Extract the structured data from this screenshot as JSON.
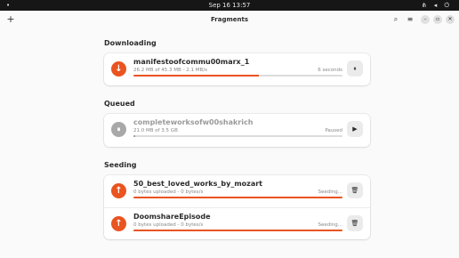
{
  "topbar": {
    "activities": "•",
    "clock": "Sep 16  13:57",
    "system": "⋔ ◂ ⏻"
  },
  "header": {
    "add_icon": "+",
    "title": "Fragments",
    "search_icon": "⌕",
    "menu_icon": "≡",
    "minimize_icon": "–",
    "maximize_icon": "▫",
    "close_icon": "✕"
  },
  "sections": {
    "downloading": "Downloading",
    "queued": "Queued",
    "seeding": "Seeding"
  },
  "downloading": [
    {
      "name": "manifestoofcommu00marx_1",
      "sub": "26.2 MB of 45.3 MB - 2.1 MB/s",
      "status": "6 seconds",
      "progress": 0.6,
      "icon": "↓",
      "action_icon": "⏸"
    }
  ],
  "queued": [
    {
      "name": "completeworksofw00shakrich",
      "sub": "21.0 MB of 3.5 GB",
      "status": "Paused",
      "progress": 0.01,
      "icon": "⏸",
      "action_icon": "▶"
    }
  ],
  "seeding": [
    {
      "name": "50_best_loved_works_by_mozart",
      "sub": "0 bytes uploaded - 0 bytes/s",
      "status": "Seeding...",
      "progress": 1.0,
      "icon": "↑",
      "action_icon": "🗑"
    },
    {
      "name": "DoomshareEpisode",
      "sub": "0 bytes uploaded - 0 bytes/s",
      "status": "Seeding...",
      "progress": 1.0,
      "icon": "↑",
      "action_icon": "🗑"
    }
  ],
  "colors": {
    "accent": "#e95420",
    "paused": "#a8a8a8"
  }
}
